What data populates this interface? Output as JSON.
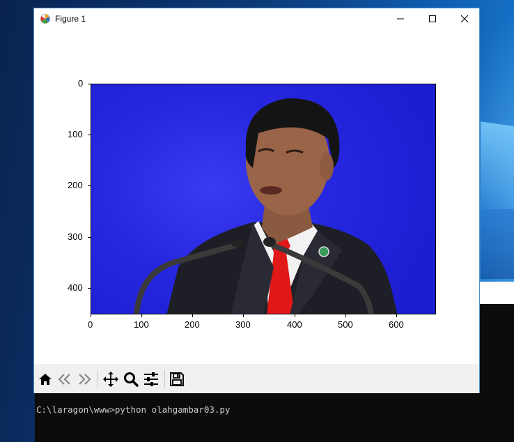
{
  "window": {
    "title": "Figure 1",
    "minimize_icon": "minimize-icon",
    "maximize_icon": "maximize-icon",
    "close_icon": "close-icon"
  },
  "plot": {
    "image_description_icon": "photo-image",
    "y_ticks": [
      "0",
      "100",
      "200",
      "300",
      "400"
    ],
    "x_ticks": [
      "0",
      "100",
      "200",
      "300",
      "400",
      "500",
      "600"
    ]
  },
  "toolbar": {
    "buttons": [
      {
        "name": "home-icon"
      },
      {
        "name": "back-icon"
      },
      {
        "name": "forward-icon"
      },
      {
        "name": "pan-icon"
      },
      {
        "name": "zoom-icon"
      },
      {
        "name": "configure-subplots-icon"
      },
      {
        "name": "save-icon"
      }
    ]
  },
  "console": {
    "line": "C:\\laragon\\www>python olahgambar03.py"
  },
  "colors": {
    "image_background": "#2626e0",
    "window_border": "#4a90d0",
    "toolbar_bg": "#f0f0f0",
    "console_bg": "#0c0c0c"
  }
}
